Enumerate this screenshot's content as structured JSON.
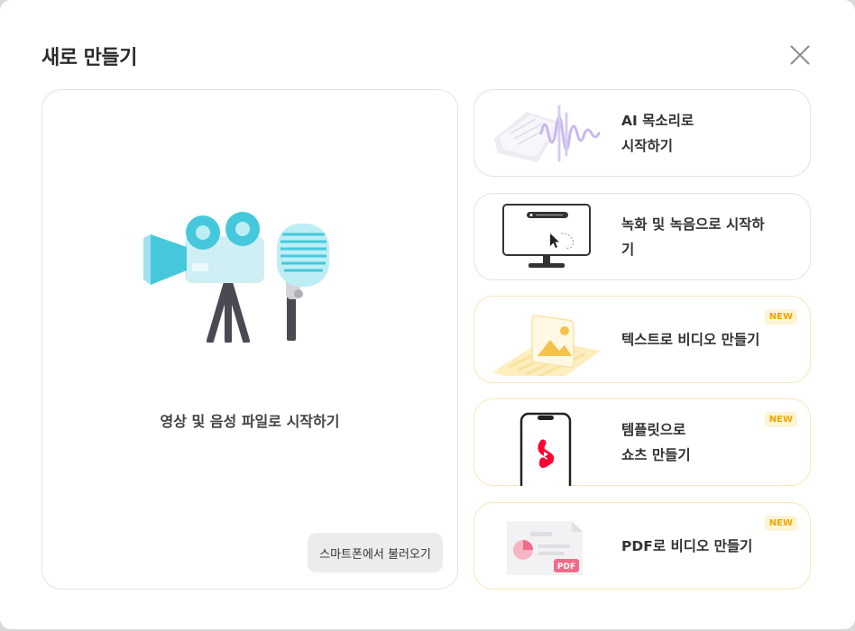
{
  "dialog": {
    "title": "새로 만들기",
    "close_icon": "close-icon"
  },
  "main_card": {
    "label": "영상 및 음성 파일로 시작하기",
    "phone_button_label": "스마트폰에서 불러오기",
    "illustration": "camera-microphone-illustration"
  },
  "options": [
    {
      "label": "AI 목소리로\n시작하기",
      "icon": "audio-waveform-illustration",
      "badge": ""
    },
    {
      "label": "녹화 및 녹음으로 시작하\n기",
      "icon": "screen-recording-illustration",
      "badge": ""
    },
    {
      "label": "텍스트로 비디오 만들기",
      "icon": "text-to-video-illustration",
      "badge": "NEW"
    },
    {
      "label": "템플릿으로\n쇼츠 만들기",
      "icon": "shorts-phone-illustration",
      "badge": "NEW"
    },
    {
      "label": "PDF로 비디오 만들기",
      "icon": "pdf-document-illustration",
      "badge": "NEW"
    }
  ],
  "colors": {
    "accent_teal": "#46c8dc",
    "new_badge_bg": "#fff4d6",
    "new_badge_text": "#f0a500",
    "shorts_red": "#ff0033",
    "pdf_pink": "#f06b8a"
  }
}
